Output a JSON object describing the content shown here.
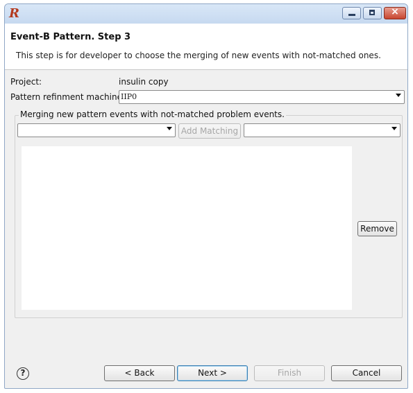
{
  "window": {
    "logo_text": "R",
    "close_glyph": "×"
  },
  "header": {
    "title": "Event-B Pattern. Step 3",
    "description": "This step is for developer to choose the merging of new events with not-matched ones."
  },
  "form": {
    "project_label": "Project:",
    "project_value": "insulin copy",
    "machine_label": "Pattern refinment machine",
    "machine_value": "IIP0"
  },
  "merge_group": {
    "title": "Merging new pattern events with not-matched problem events.",
    "left_select": "",
    "add_matching_label": "Add Matching",
    "right_select": "",
    "remove_label": "Remove",
    "matches": []
  },
  "footer": {
    "help_glyph": "?",
    "back_label": "< Back",
    "next_label": "Next >",
    "finish_label": "Finish",
    "cancel_label": "Cancel"
  },
  "icons": {
    "logo": "r-logo-icon",
    "minimize": "minimize-icon",
    "maximize": "maximize-icon",
    "close": "close-icon",
    "dropdown": "chevron-down-icon",
    "help": "help-icon"
  }
}
